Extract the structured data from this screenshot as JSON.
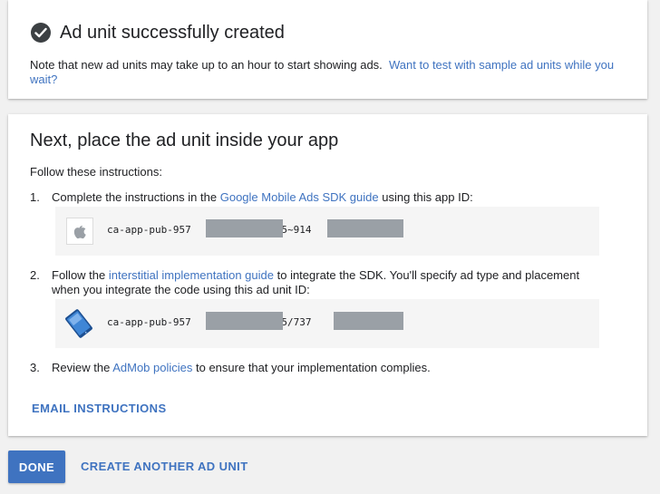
{
  "success_card": {
    "title": "Ad unit successfully created",
    "note_text": "Note that new ad units may take up to an hour to start showing ads.",
    "note_link": "Want to test with sample ad units while you wait?",
    "icon": "check-circle-icon"
  },
  "instructions_card": {
    "title": "Next, place the ad unit inside your app",
    "intro": "Follow these instructions:",
    "step1": {
      "number": "1.",
      "text_before": "Complete the instructions in the",
      "link": "Google Mobile Ads SDK guide",
      "text_after": "using this app ID:",
      "id_prefix": "ca-app-pub-957",
      "id_middle": "75~914",
      "icon": "apple-icon"
    },
    "step2": {
      "number": "2.",
      "text_before": "Follow the",
      "link": "interstitial implementation guide",
      "text_after": "to integrate the SDK. You'll specify ad type and placement when you integrate the code using this ad unit ID:",
      "id_prefix": "ca-app-pub-957",
      "id_middle": "75/737",
      "icon": "interstitial-ad-icon"
    },
    "step3": {
      "number": "3.",
      "text_before": "Review the",
      "link": "AdMob policies",
      "text_after": "to ensure that your implementation complies."
    },
    "email_button": "EMAIL INSTRUCTIONS"
  },
  "footer": {
    "done_button": "DONE",
    "create_button": "CREATE ANOTHER AD UNIT"
  },
  "colors": {
    "accent": "#3f73c0",
    "background": "#f1f1f1",
    "redaction": "#9aa0a6"
  }
}
